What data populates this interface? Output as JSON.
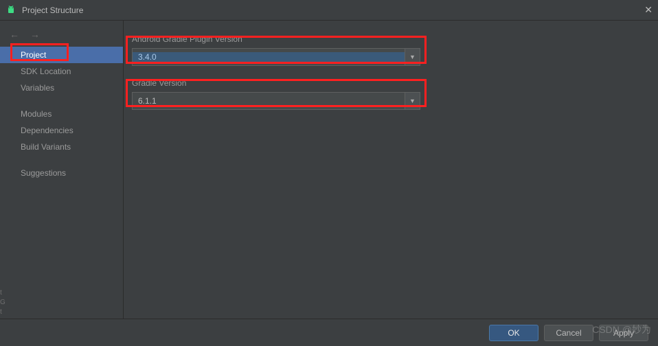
{
  "titlebar": {
    "title": "Project Structure"
  },
  "sidebar": {
    "items": [
      {
        "label": "Project",
        "selected": true
      },
      {
        "label": "SDK Location",
        "selected": false
      },
      {
        "label": "Variables",
        "selected": false
      },
      {
        "label": "Modules",
        "selected": false
      },
      {
        "label": "Dependencies",
        "selected": false
      },
      {
        "label": "Build Variants",
        "selected": false
      },
      {
        "label": "Suggestions",
        "selected": false
      }
    ]
  },
  "content": {
    "field1_label": "Android Gradle Plugin Version",
    "field1_value": "3.4.0",
    "field2_label": "Gradle Version",
    "field2_value": "6.1.1"
  },
  "buttons": {
    "ok": "OK",
    "cancel": "Cancel",
    "apply": "Apply"
  },
  "watermark": "CSDN @妙为"
}
